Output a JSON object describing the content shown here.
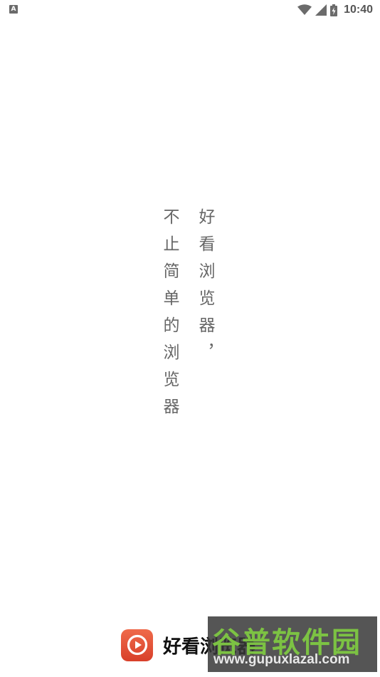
{
  "status_bar": {
    "notification_icon": "A",
    "time": "10:40",
    "icons": [
      "wifi-icon",
      "signal-icon",
      "battery-charging-icon"
    ]
  },
  "slogan": {
    "column_1": "好看浏览器，",
    "column_2": "不止简单的浏览器"
  },
  "footer": {
    "logo_icon": "play-circle-icon",
    "app_name": "好看浏览器"
  },
  "watermark": {
    "title": "谷普软件园",
    "url": "www.gupuxlazal.com"
  },
  "colors": {
    "logo_gradient_top": "#ef6a4a",
    "logo_gradient_bottom": "#d8402a",
    "watermark_green": "#7cc243"
  }
}
